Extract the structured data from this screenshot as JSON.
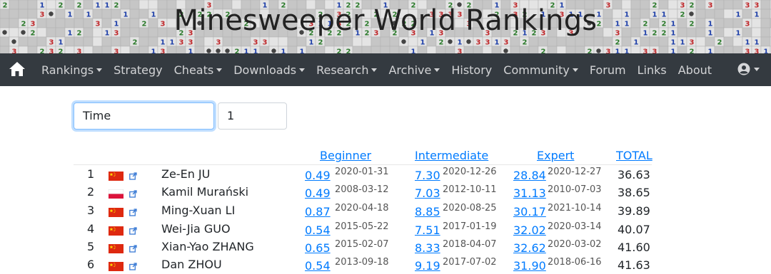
{
  "site": {
    "title": "Minesweeper World Rankings"
  },
  "nav": {
    "home_icon": "home-icon",
    "items": [
      {
        "label": "Rankings",
        "dropdown": true
      },
      {
        "label": "Strategy",
        "dropdown": false
      },
      {
        "label": "Cheats",
        "dropdown": true
      },
      {
        "label": "Downloads",
        "dropdown": true
      },
      {
        "label": "Research",
        "dropdown": true
      },
      {
        "label": "Archive",
        "dropdown": true
      },
      {
        "label": "History",
        "dropdown": false
      },
      {
        "label": "Community",
        "dropdown": true
      },
      {
        "label": "Forum",
        "dropdown": false
      },
      {
        "label": "Links",
        "dropdown": false
      },
      {
        "label": "About",
        "dropdown": false
      }
    ],
    "user_icon": "user-circle-icon"
  },
  "controls": {
    "sort_select": "Time",
    "number_input": "1"
  },
  "table": {
    "headers": {
      "beginner": "Beginner",
      "intermediate": "Intermediate",
      "expert": "Expert",
      "total": "TOTAL"
    },
    "rows": [
      {
        "rank": "1",
        "flag": "china-flag",
        "name": "Ze-En JU",
        "beg": "0.49",
        "beg_date": "2020-01-31",
        "int": "7.30",
        "int_date": "2020-12-26",
        "exp": "28.84",
        "exp_date": "2020-12-27",
        "total": "36.63"
      },
      {
        "rank": "2",
        "flag": "poland-flag",
        "name": "Kamil Murański",
        "beg": "0.49",
        "beg_date": "2008-03-12",
        "int": "7.03",
        "int_date": "2012-10-11",
        "exp": "31.13",
        "exp_date": "2010-07-03",
        "total": "38.65"
      },
      {
        "rank": "3",
        "flag": "china-flag",
        "name": "Ming-Xuan LI",
        "beg": "0.87",
        "beg_date": "2020-04-18",
        "int": "8.85",
        "int_date": "2020-08-25",
        "exp": "30.17",
        "exp_date": "2021-10-14",
        "total": "39.89"
      },
      {
        "rank": "4",
        "flag": "china-flag",
        "name": "Wei-Jia GUO",
        "beg": "0.54",
        "beg_date": "2015-05-22",
        "int": "7.51",
        "int_date": "2017-01-19",
        "exp": "32.02",
        "exp_date": "2020-03-14",
        "total": "40.07"
      },
      {
        "rank": "5",
        "flag": "china-flag",
        "name": "Xian-Yao ZHANG",
        "beg": "0.65",
        "beg_date": "2015-02-07",
        "int": "8.33",
        "int_date": "2018-04-07",
        "exp": "32.62",
        "exp_date": "2020-03-02",
        "total": "41.60"
      },
      {
        "rank": "6",
        "flag": "china-flag",
        "name": "Dan ZHOU",
        "beg": "0.54",
        "beg_date": "2013-09-18",
        "int": "9.19",
        "int_date": "2017-07-02",
        "exp": "31.90",
        "exp_date": "2018-06-16",
        "total": "41.63"
      }
    ]
  },
  "colors": {
    "navbar_bg": "#343a40",
    "link": "#007bff",
    "china_red": "#de2910",
    "china_yellow": "#ffde00",
    "poland_red": "#dc143c"
  }
}
